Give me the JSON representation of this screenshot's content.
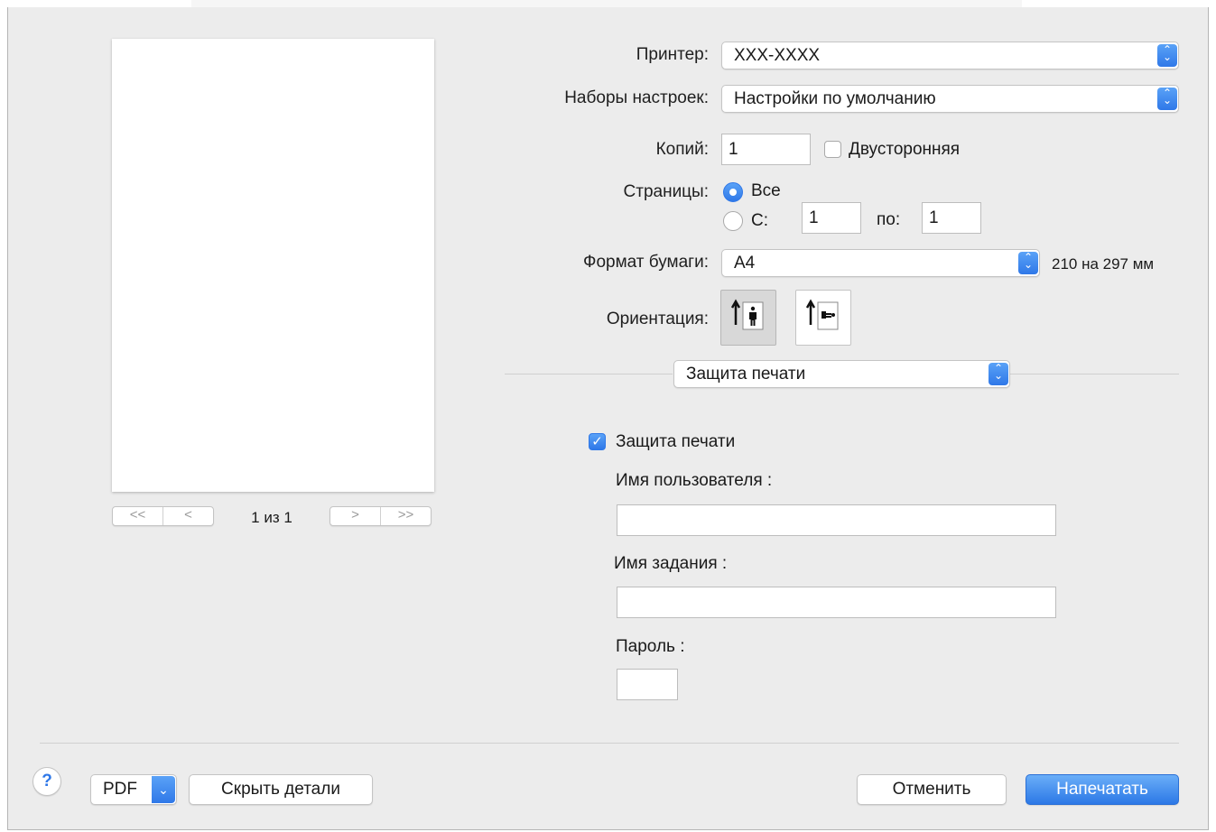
{
  "dialog": {
    "printer": {
      "label": "Принтер:",
      "value": "XXX-XXXX"
    },
    "presets": {
      "label": "Наборы настроек:",
      "value": "Настройки по умолчанию"
    },
    "copies": {
      "label": "Копий:",
      "value": "1",
      "two_sided_label": "Двусторонняя",
      "two_sided_checked": false
    },
    "pages": {
      "label": "Страницы:",
      "all_label": "Все",
      "all_selected": true,
      "from_label": "С:",
      "from_value": "1",
      "to_label": "по:",
      "to_value": "1"
    },
    "paper": {
      "label": "Формат бумаги:",
      "value": "A4",
      "size_text": "210 на 297 мм"
    },
    "orientation": {
      "label": "Ориентация:",
      "selected": "portrait"
    },
    "section_popup": {
      "value": "Защита печати"
    },
    "secure_print": {
      "checkbox_label": "Защита печати",
      "checked": true,
      "user_name_label": "Имя пользователя :",
      "user_name_value": "",
      "job_name_label": "Имя задания :",
      "job_name_value": "",
      "password_label": "Пароль :",
      "password_value": ""
    },
    "preview": {
      "page_counter": "1 из 1",
      "first": "<<",
      "prev": "<",
      "next": ">",
      "last": ">>"
    },
    "footer": {
      "help": "?",
      "pdf_label": "PDF",
      "hide_details_label": "Скрыть детали",
      "cancel_label": "Отменить",
      "print_label": "Напечатать"
    }
  },
  "colors": {
    "accent": "#2f78e8",
    "dialog_bg": "#ececec"
  }
}
